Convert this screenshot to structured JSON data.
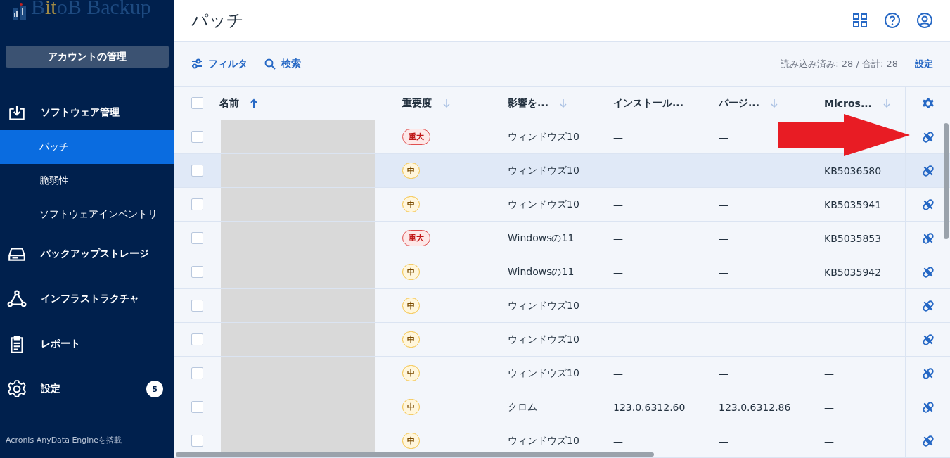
{
  "sidebar": {
    "logo": {
      "prefix": "B",
      "highlight": "it",
      "suffix": "oB Backup"
    },
    "account_button": "アカウントの管理",
    "items": [
      {
        "label": "ソフトウェア管理",
        "children": [
          {
            "label": "パッチ",
            "selected": true
          },
          {
            "label": "脆弱性",
            "selected": false
          },
          {
            "label": "ソフトウェアインベントリ",
            "selected": false
          }
        ]
      },
      {
        "label": "バックアップストレージ"
      },
      {
        "label": "インフラストラクチャ"
      },
      {
        "label": "レポート"
      },
      {
        "label": "設定",
        "badge": "5"
      }
    ],
    "footer": "Acronis AnyData Engineを搭載"
  },
  "header": {
    "title": "パッチ"
  },
  "toolbar": {
    "filter": "フィルタ",
    "search": "検索",
    "count": "読み込み済み: 28 / 合計: 28",
    "settings": "設定"
  },
  "table": {
    "select_all_checked": false,
    "columns": [
      {
        "label": "名前"
      },
      {
        "label": "重要度"
      },
      {
        "label": "影響を..."
      },
      {
        "label": "インストール..."
      },
      {
        "label": "バージ..."
      },
      {
        "label": "Micros..."
      }
    ],
    "rows": [
      {
        "severity": "重大",
        "kind": "critical",
        "affected": "ウィンドウズ10",
        "installed": "—",
        "version": "—",
        "kb": null,
        "highlighted": false
      },
      {
        "severity": "中",
        "kind": "medium",
        "affected": "ウィンドウズ10",
        "installed": "—",
        "version": "—",
        "kb": "KB5036580",
        "highlighted": true
      },
      {
        "severity": "中",
        "kind": "medium",
        "affected": "ウィンドウズ10",
        "installed": "—",
        "version": "—",
        "kb": "KB5035941",
        "highlighted": false
      },
      {
        "severity": "重大",
        "kind": "critical",
        "affected": "Windowsの11",
        "installed": "—",
        "version": "—",
        "kb": "KB5035853",
        "highlighted": false
      },
      {
        "severity": "中",
        "kind": "medium",
        "affected": "Windowsの11",
        "installed": "—",
        "version": "—",
        "kb": "KB5035942",
        "highlighted": false
      },
      {
        "severity": "中",
        "kind": "medium",
        "affected": "ウィンドウズ10",
        "installed": "—",
        "version": "—",
        "kb": "—",
        "highlighted": false
      },
      {
        "severity": "中",
        "kind": "medium",
        "affected": "ウィンドウズ10",
        "installed": "—",
        "version": "—",
        "kb": "—",
        "highlighted": false
      },
      {
        "severity": "中",
        "kind": "medium",
        "affected": "ウィンドウズ10",
        "installed": "—",
        "version": "—",
        "kb": "—",
        "highlighted": false
      },
      {
        "severity": "中",
        "kind": "medium",
        "affected": "クロム",
        "installed": "123.0.6312.60",
        "version": "123.0.6312.86",
        "kb": "—",
        "highlighted": false
      },
      {
        "severity": "中",
        "kind": "medium",
        "affected": "ウィンドウズ10",
        "installed": "—",
        "version": "—",
        "kb": "—",
        "highlighted": false
      }
    ]
  }
}
